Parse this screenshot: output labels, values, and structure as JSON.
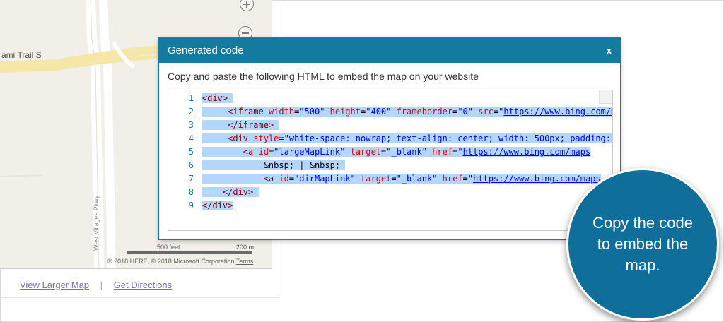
{
  "map": {
    "road_label": "ami Trail S",
    "vertical_road_label": "West Villages Pkwy",
    "scale_primary": "500 feet",
    "scale_secondary": "200 m",
    "copyright": "© 2018 HERE, © 2018 Microsoft Corporation",
    "terms_label": "Terms",
    "zoom_in_icon": "plus-icon",
    "zoom_out_icon": "minus-icon"
  },
  "map_links": {
    "larger_map": "View Larger Map",
    "separator": "|",
    "directions": "Get Directions",
    "link_color": "#7070c8"
  },
  "dialog": {
    "title": "Generated code",
    "close_label": "x",
    "description": "Copy and paste the following HTML to embed the map on your website",
    "header_color": "#137aa0",
    "line_numbers": [
      "1",
      "2",
      "3",
      "4",
      "5",
      "6",
      "7",
      "8",
      "9"
    ]
  },
  "callout": {
    "text": "Copy the code to embed the map.",
    "color": "#0f6f9a"
  }
}
